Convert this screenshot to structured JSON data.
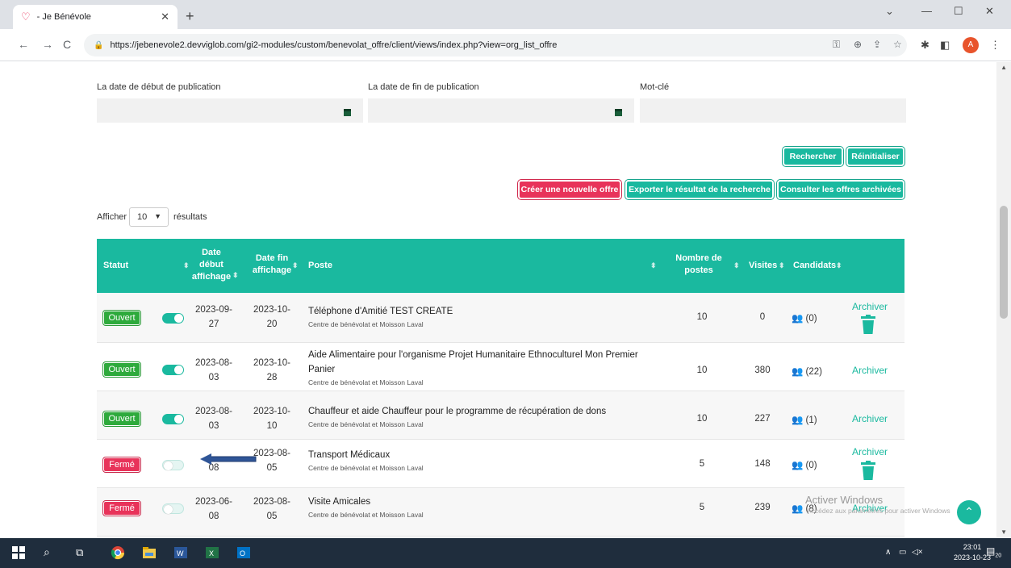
{
  "browser": {
    "tab_title": "- Je Bénévole",
    "url": "https://jebenevole2.devviglob.com/gi2-modules/custom/benevolat_offre/client/views/index.php?view=org_list_offre",
    "avatar_letter": "A"
  },
  "filters": {
    "start_label": "La date de début de publication",
    "end_label": "La date de fin de publication",
    "keyword_label": "Mot-clé"
  },
  "buttons": {
    "search": "Rechercher",
    "reset": "Réinitialiser",
    "create": "Créer une nouvelle offre",
    "export": "Exporter le résultat de la recherche",
    "archived": "Consulter les offres archivées"
  },
  "pager": {
    "show": "Afficher",
    "value": "10",
    "results": "résultats"
  },
  "table": {
    "headers": {
      "status": "Statut",
      "start": "Date début affichage",
      "end": "Date fin affichage",
      "post": "Poste",
      "count": "Nombre de postes",
      "visits": "Visites",
      "candidates": "Candidats"
    },
    "rows": [
      {
        "status": "Ouvert",
        "start": "2023-09-27",
        "end": "2023-10-20",
        "title": "Téléphone d'Amitié TEST CREATE",
        "org": "Centre de bénévolat et Moisson Laval",
        "count": "10",
        "visits": "0",
        "cand": "(0)",
        "action": "Archiver"
      },
      {
        "status": "Ouvert",
        "start": "2023-08-03",
        "end": "2023-10-28",
        "title": "Aide Alimentaire pour l'organisme Projet Humanitaire Ethnoculturel Mon Premier Panier",
        "org": "Centre de bénévolat et Moisson Laval",
        "count": "10",
        "visits": "380",
        "cand": "(22)",
        "action": "Archiver"
      },
      {
        "status": "Ouvert",
        "start": "2023-08-03",
        "end": "2023-10-10",
        "title": "Chauffeur et aide Chauffeur pour le programme de récupération de dons",
        "org": "Centre de bénévolat et Moisson Laval",
        "count": "10",
        "visits": "227",
        "cand": "(1)",
        "action": "Archiver"
      },
      {
        "status": "Fermé",
        "start": "08",
        "end": "2023-08-05",
        "title": "Transport Médicaux",
        "org": "Centre de bénévolat et Moisson Laval",
        "count": "5",
        "visits": "148",
        "cand": "(0)",
        "action": "Archiver"
      },
      {
        "status": "Fermé",
        "start": "2023-06-08",
        "end": "2023-08-05",
        "title": "Visite Amicales",
        "org": "Centre de bénévolat et Moisson Laval",
        "count": "5",
        "visits": "239",
        "cand": "(8)",
        "action": "Archiver"
      }
    ]
  },
  "watermark": {
    "line1": "Activer Windows",
    "line2": "Accédez aux paramètres pour activer Windows"
  },
  "taskbar": {
    "time": "23:01",
    "date": "2023-10-23",
    "notif_count": "20"
  },
  "colors": {
    "accent": "#1ab99f",
    "danger": "#e8335a",
    "open": "#2eaa3c"
  }
}
